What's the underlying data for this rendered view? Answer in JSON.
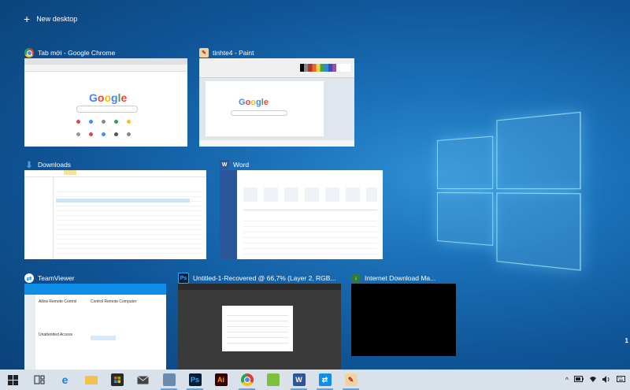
{
  "new_desktop": {
    "label": "New desktop"
  },
  "windows": {
    "chrome": {
      "title": "Tab mới - Google Chrome",
      "icon": "chrome-icon"
    },
    "paint": {
      "title": "tinhte4 - Paint",
      "icon": "paint-icon"
    },
    "downloads": {
      "title": "Downloads",
      "icon": "download-folder-icon"
    },
    "word": {
      "title": "Word",
      "icon": "word-icon"
    },
    "teamviewer": {
      "title": "TeamViewer",
      "icon": "teamviewer-icon",
      "allow_label": "Allow Remote Control",
      "control_label": "Control Remote Computer",
      "unattended_label": "Unattended Access"
    },
    "photoshop": {
      "title": "Untitled-1-Recovered @ 66,7% (Layer 2, RGB...",
      "icon": "photoshop-icon"
    },
    "idm": {
      "title": "Internet Download Ma...",
      "icon": "internet-download-manager-icon"
    }
  },
  "google_logo": "Google",
  "side_indicator": "1",
  "taskbar": {
    "items": [
      {
        "name": "start-button",
        "icon": "windows-icon"
      },
      {
        "name": "task-view-button",
        "icon": "task-view-icon"
      },
      {
        "name": "edge-button",
        "icon": "edge-icon"
      },
      {
        "name": "file-explorer-button",
        "icon": "folder-icon"
      },
      {
        "name": "store-button",
        "icon": "store-icon"
      },
      {
        "name": "mail-button",
        "icon": "mail-icon"
      },
      {
        "name": "app-button",
        "icon": "app-icon"
      },
      {
        "name": "photoshop-button",
        "icon": "photoshop-icon",
        "label": "Ps"
      },
      {
        "name": "illustrator-button",
        "icon": "illustrator-icon",
        "label": "Ai"
      },
      {
        "name": "chrome-button",
        "icon": "chrome-icon"
      },
      {
        "name": "notepad-button",
        "icon": "notepad-icon"
      },
      {
        "name": "word-button",
        "icon": "word-icon",
        "label": "W"
      },
      {
        "name": "teamviewer-button",
        "icon": "teamviewer-icon"
      },
      {
        "name": "paint-button",
        "icon": "paint-icon"
      }
    ]
  },
  "colors": {
    "desktop": "#1a6fb6",
    "taskbar": "#d9e1ea",
    "accent": "#5aa3e8"
  }
}
